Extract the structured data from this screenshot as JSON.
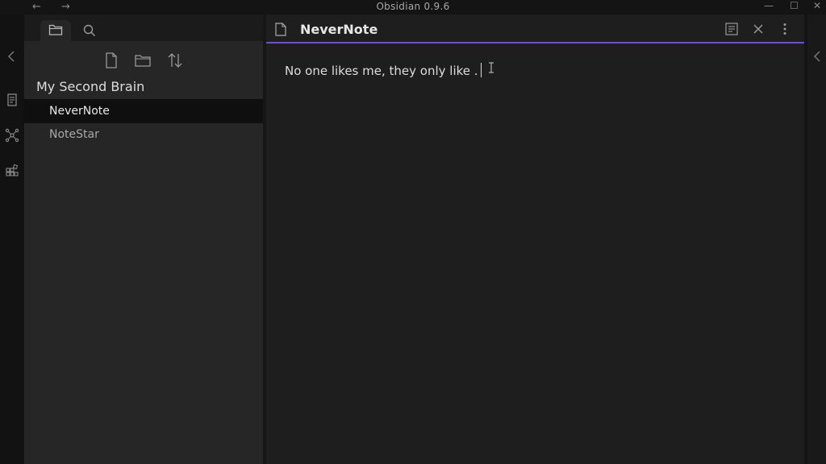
{
  "window": {
    "title": "Obsidian 0.9.6",
    "back_icon": "arrow-left-icon",
    "forward_icon": "arrow-right-icon"
  },
  "sidebar": {
    "vault_name": "My Second Brain",
    "files": [
      {
        "label": "NeverNote",
        "active": true
      },
      {
        "label": "NoteStar",
        "active": false
      }
    ]
  },
  "editor": {
    "tab_title": "NeverNote",
    "content": "No one likes me, they only like ."
  },
  "colors": {
    "accent": "#6c4fd6",
    "background": "#1e1e1e",
    "sidebar": "#262626"
  }
}
